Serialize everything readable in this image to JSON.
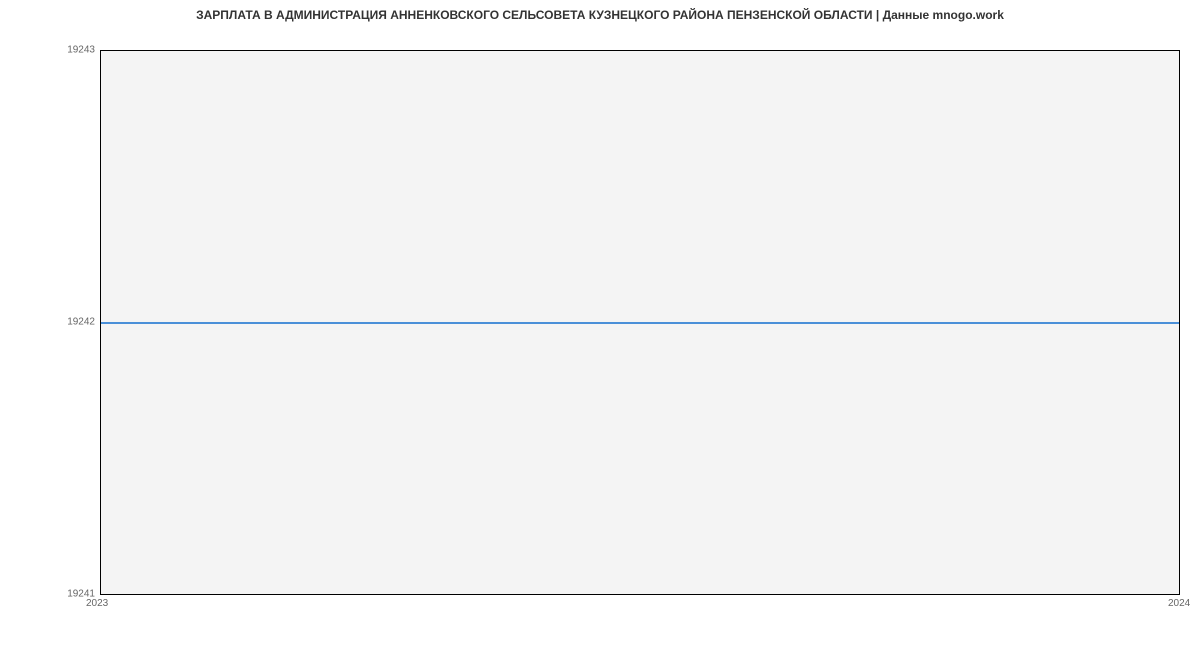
{
  "chart_data": {
    "type": "line",
    "title": "ЗАРПЛАТА В АДМИНИСТРАЦИЯ АННЕНКОВСКОГО СЕЛЬСОВЕТА КУЗНЕЦКОГО РАЙОНА ПЕНЗЕНСКОЙ ОБЛАСТИ | Данные mnogo.work",
    "x": [
      2023,
      2024
    ],
    "values": [
      19242,
      19242
    ],
    "xlabel": "",
    "ylabel": "",
    "xlim": [
      2023,
      2024
    ],
    "ylim": [
      19241,
      19243
    ],
    "y_ticks": [
      19241,
      19242,
      19243
    ],
    "x_ticks": [
      2023,
      2024
    ]
  },
  "y_labels": {
    "t0": "19241",
    "t1": "19242",
    "t2": "19243"
  },
  "x_labels": {
    "t0": "2023",
    "t1": "2024"
  }
}
